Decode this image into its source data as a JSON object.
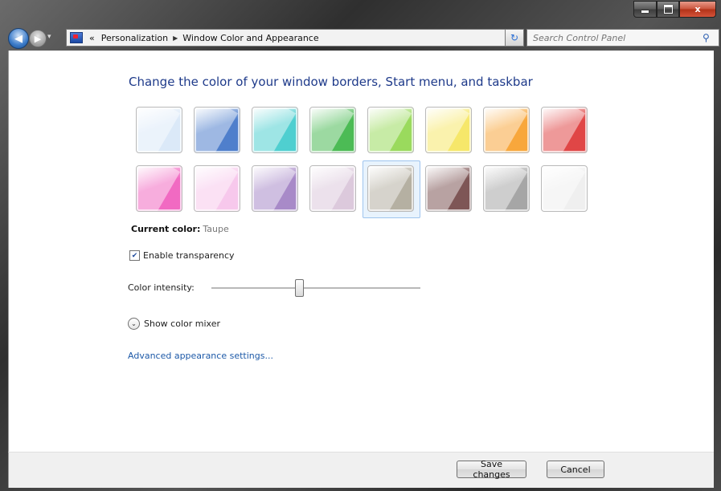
{
  "window": {
    "caption": {
      "minimize": "",
      "maximize": "",
      "close": "x"
    }
  },
  "navbar": {
    "back_glyph": "◀",
    "forward_glyph": "▶",
    "history_dropdown_glyph": "▾",
    "breadcrumb": {
      "overflow": "«",
      "items": [
        "Personalization",
        "Window Color and Appearance"
      ],
      "separator": "▶"
    },
    "address_dropdown_glyph": "▾",
    "refresh_glyph": "↻",
    "search": {
      "placeholder": "Search Control Panel",
      "value": ""
    },
    "search_glyph": "⚲"
  },
  "main": {
    "heading": "Change the color of your window borders, Start menu, and taskbar",
    "swatches": [
      [
        {
          "color": "#dbe9f8",
          "selected": false
        },
        {
          "color": "#4f7fcc",
          "selected": false
        },
        {
          "color": "#4fcfd0",
          "selected": false
        },
        {
          "color": "#4cbb55",
          "selected": false
        },
        {
          "color": "#9ada5d",
          "selected": false
        },
        {
          "color": "#f6e76a",
          "selected": false
        },
        {
          "color": "#f8a73c",
          "selected": false
        },
        {
          "color": "#e04646",
          "selected": false
        }
      ],
      [
        {
          "color": "#f16ac2",
          "selected": false
        },
        {
          "color": "#f7c8ec",
          "selected": false
        },
        {
          "color": "#a88ac8",
          "selected": false
        },
        {
          "color": "#dcc9dc",
          "selected": false
        },
        {
          "color": "#b5b0a2",
          "selected": true
        },
        {
          "color": "#7e5656",
          "selected": false
        },
        {
          "color": "#a6a6a6",
          "selected": false
        },
        {
          "color": "#efefef",
          "selected": false
        }
      ]
    ],
    "current_color": {
      "label": "Current color:",
      "value": "Taupe"
    },
    "transparency": {
      "label": "Enable transparency",
      "checked": true,
      "check_glyph": "✔"
    },
    "intensity": {
      "label": "Color intensity:",
      "value_fraction": 0.42
    },
    "color_mixer": {
      "label": "Show color mixer",
      "glyph": "⌄"
    },
    "advanced_link": "Advanced appearance settings..."
  },
  "footer": {
    "save_label": "Save changes",
    "cancel_label": "Cancel"
  }
}
